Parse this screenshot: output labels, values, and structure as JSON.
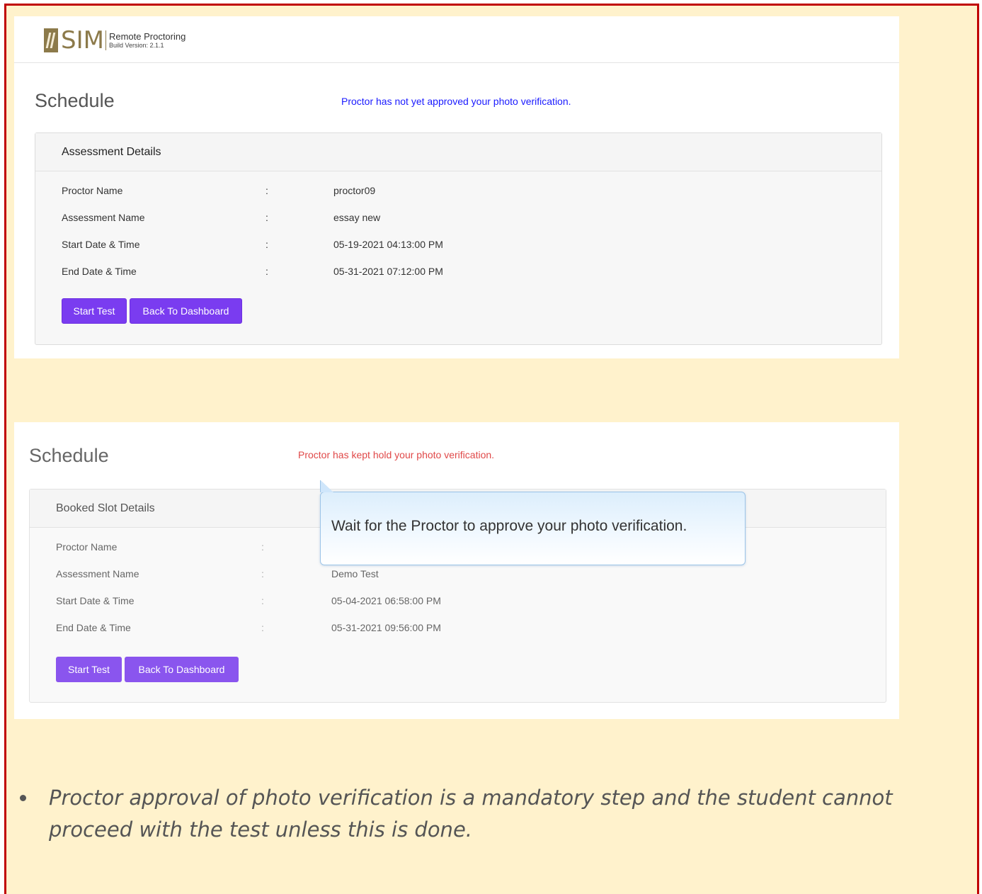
{
  "screen1": {
    "logo": {
      "brand": "SIM",
      "title": "Remote Proctoring",
      "build": "Build Version: 2.1.1"
    },
    "page_title": "Schedule",
    "status_message": "Proctor has not yet approved your photo verification.",
    "panel_title": "Assessment Details",
    "rows": [
      {
        "label": "Proctor Name",
        "colon": ":",
        "value": "proctor09"
      },
      {
        "label": "Assessment Name",
        "colon": ":",
        "value": "essay new"
      },
      {
        "label": "Start Date & Time",
        "colon": ":",
        "value": "05-19-2021 04:13:00 PM"
      },
      {
        "label": "End Date & Time",
        "colon": ":",
        "value": "05-31-2021 07:12:00 PM"
      }
    ],
    "start_button": "Start Test",
    "back_button": "Back To Dashboard"
  },
  "screen2": {
    "page_title": "Schedule",
    "status_message": "Proctor has kept hold your photo verification.",
    "panel_title": "Booked Slot Details",
    "rows": [
      {
        "label": "Proctor Name",
        "colon": ":",
        "value": ""
      },
      {
        "label": "Assessment Name",
        "colon": ":",
        "value": "Demo Test"
      },
      {
        "label": "Start Date & Time",
        "colon": ":",
        "value": "05-04-2021 06:58:00 PM"
      },
      {
        "label": "End Date & Time",
        "colon": ":",
        "value": "05-31-2021 09:56:00 PM"
      }
    ],
    "tooltip": "Wait for the Proctor to approve your photo verification.",
    "start_button": "Start Test",
    "back_button": "Back To Dashboard"
  },
  "note": "Proctor approval of photo verification is a mandatory step and the student cannot proceed with the test unless this is done.",
  "colors": {
    "frame_border": "#c00000",
    "frame_background": "#fff2cc",
    "button": "#7a3cf0",
    "pending_message": "#1a1aff",
    "hold_message": "#e04848"
  }
}
